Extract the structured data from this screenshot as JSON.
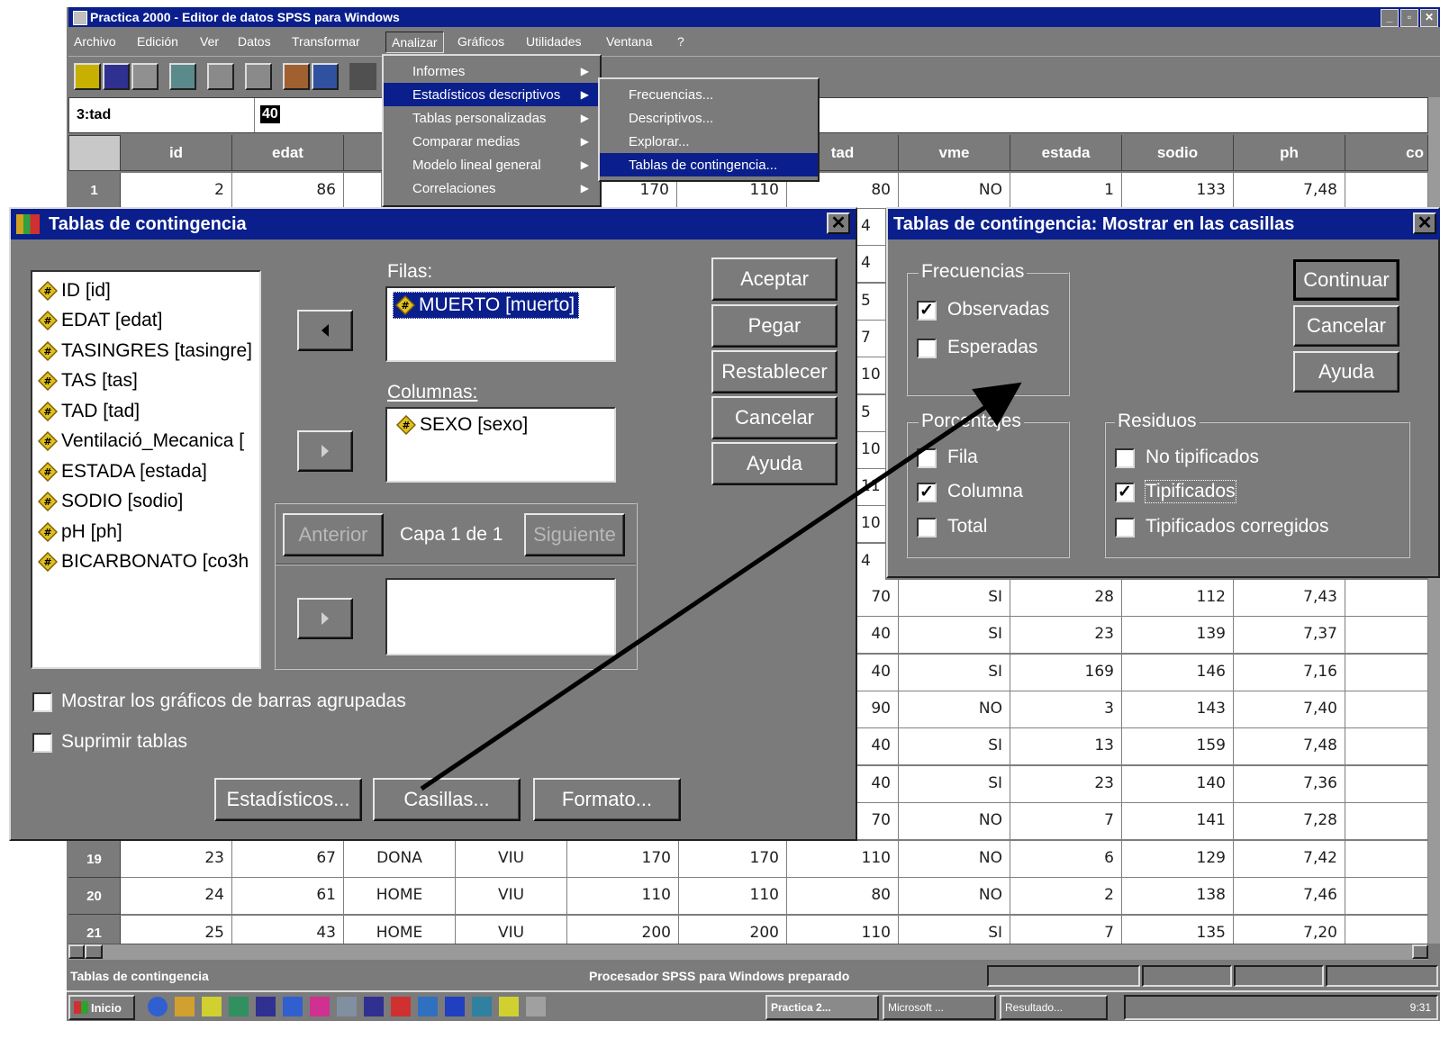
{
  "main_window": {
    "title": "Practica 2000 - Editor de datos SPSS para Windows",
    "menu": [
      "Archivo",
      "Edición",
      "Ver",
      "Datos",
      "Transformar",
      "Analizar",
      "Gráficos",
      "Utilidades",
      "Ventana",
      "?"
    ],
    "cell_ref": "3:tad",
    "cell_value": "40",
    "columns": [
      "id",
      "edat",
      "",
      "",
      "",
      "",
      "tad",
      "vme",
      "estada",
      "sodio",
      "ph",
      "co"
    ],
    "status_left": "Tablas de contingencia",
    "status_right": "Procesador SPSS para Windows preparado"
  },
  "analizar_menu": {
    "items": [
      "Informes",
      "Estadísticos descriptivos",
      "Tablas personalizadas",
      "Comparar medias",
      "Modelo lineal general",
      "Correlaciones"
    ]
  },
  "submenu": {
    "items": [
      "Frecuencias...",
      "Descriptivos...",
      "Explorar...",
      "Tablas de contingencia..."
    ]
  },
  "grid": {
    "row1": {
      "num": "1",
      "cells": [
        "2",
        "86",
        "",
        "",
        "170",
        "110",
        "80",
        "NO",
        "1",
        "133",
        "7,48"
      ]
    },
    "right_rows": [
      [
        "70",
        "SI",
        "28",
        "112",
        "7,43"
      ],
      [
        "40",
        "SI",
        "23",
        "139",
        "7,37"
      ],
      [
        "40",
        "SI",
        "169",
        "146",
        "7,16"
      ],
      [
        "90",
        "NO",
        "3",
        "143",
        "7,40"
      ],
      [
        "40",
        "SI",
        "13",
        "159",
        "7,48"
      ],
      [
        "40",
        "SI",
        "23",
        "140",
        "7,36"
      ],
      [
        "70",
        "NO",
        "7",
        "141",
        "7,28"
      ]
    ],
    "partial_tad": [
      "4",
      "4",
      "5",
      "7",
      "10",
      "5",
      "10",
      "11",
      "10",
      "4"
    ],
    "bottom_rows": [
      {
        "num": "19",
        "cells": [
          "23",
          "67",
          "DONA",
          "VIU",
          "170",
          "170",
          "110",
          "NO",
          "6",
          "129",
          "7,42"
        ]
      },
      {
        "num": "20",
        "cells": [
          "24",
          "61",
          "HOME",
          "VIU",
          "110",
          "110",
          "80",
          "NO",
          "2",
          "138",
          "7,46"
        ]
      },
      {
        "num": "21",
        "cells": [
          "25",
          "43",
          "HOME",
          "VIU",
          "200",
          "200",
          "110",
          "SI",
          "7",
          "135",
          "7,20"
        ]
      }
    ]
  },
  "crosstabs": {
    "title": "Tablas de contingencia",
    "variables": [
      "ID [id]",
      "EDAT [edat]",
      "TASINGRES [tasingre]",
      "TAS [tas]",
      "TAD [tad]",
      "Ventilació_Mecanica [",
      "ESTADA [estada]",
      "SODIO [sodio]",
      "pH [ph]",
      "BICARBONATO [co3h"
    ],
    "filas_label": "Filas:",
    "filas_item": "MUERTO [muerto]",
    "columnas_label": "Columnas:",
    "columnas_item": "SEXO [sexo]",
    "capa_text": "Capa 1 de 1",
    "btn_anterior": "Anterior",
    "btn_siguiente": "Siguiente",
    "buttons": [
      "Aceptar",
      "Pegar",
      "Restablecer",
      "Cancelar",
      "Ayuda"
    ],
    "chk_barras": "Mostrar los gráficos de barras agrupadas",
    "chk_suprimir": "Suprimir tablas",
    "btn_estadisticos": "Estadísticos...",
    "btn_casillas": "Casillas...",
    "btn_formato": "Formato..."
  },
  "cells_dialog": {
    "title": "Tablas de contingencia: Mostrar en las casillas",
    "frecuencias": "Frecuencias",
    "observadas": "Observadas",
    "esperadas": "Esperadas",
    "porcentajes": "Porcentajes",
    "fila": "Fila",
    "columna": "Columna",
    "total": "Total",
    "residuos": "Residuos",
    "no_tipificados": "No tipificados",
    "tipificados": "Tipificados",
    "tipificados_corregidos": "Tipificados corregidos",
    "btn_continuar": "Continuar",
    "btn_cancelar": "Cancelar",
    "btn_ayuda": "Ayuda",
    "checked": {
      "observadas": true,
      "esperadas": false,
      "fila": false,
      "columna": true,
      "total": false,
      "no_tipificados": false,
      "tipificados": true,
      "tipificados_corregidos": false
    }
  },
  "taskbar": {
    "start": "Inicio",
    "tasks": [
      "Practica 2...",
      "Microsoft ...",
      "Resultado..."
    ],
    "clock": "9:31"
  },
  "colors": {
    "titlebar": "#0a1f8c",
    "face": "#7b7b7b",
    "arrow": "#000000"
  }
}
